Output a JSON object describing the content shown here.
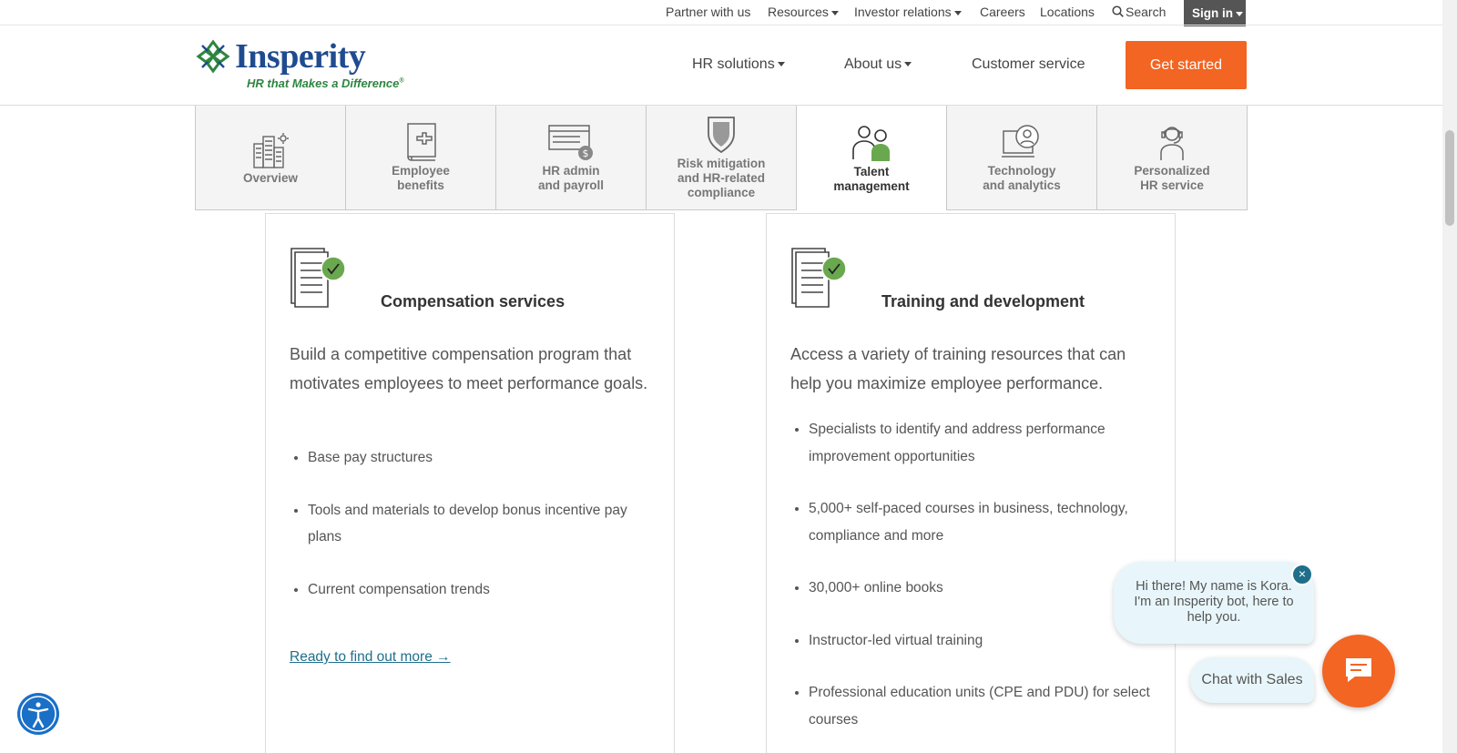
{
  "utility_nav": {
    "partner": "Partner with us",
    "resources": "Resources",
    "investor": "Investor relations",
    "careers": "Careers",
    "locations": "Locations",
    "search": "Search",
    "signin": "Sign in"
  },
  "header": {
    "logo_text": "Insperity",
    "logo_tagline": "HR that Makes a Difference",
    "nav": {
      "hr_solutions": "HR solutions",
      "about_us": "About us",
      "customer_service": "Customer service"
    },
    "cta": "Get started"
  },
  "tabs": [
    {
      "label": "Overview",
      "icon": "buildings-icon"
    },
    {
      "label": "Employee\nbenefits",
      "icon": "medical-book-icon"
    },
    {
      "label": "HR admin\nand payroll",
      "icon": "payroll-check-icon"
    },
    {
      "label": "Risk mitigation\nand HR-related\ncompliance",
      "icon": "shield-icon"
    },
    {
      "label": "Talent\nmanagement",
      "icon": "people-icon",
      "active": true
    },
    {
      "label": "Technology\nand analytics",
      "icon": "monitor-user-icon"
    },
    {
      "label": "Personalized\nHR service",
      "icon": "headset-person-icon"
    }
  ],
  "cards": [
    {
      "title": "Compensation services",
      "intro": "Build a competitive compensation program that motivates employees to meet performance goals.",
      "items": [
        "Base pay structures",
        "Tools and materials to develop bonus incentive pay plans",
        "Current compensation trends"
      ],
      "link": "Ready to find out more →"
    },
    {
      "title": "Training and development",
      "intro": "Access a variety of training resources that can help you maximize employee performance.",
      "items": [
        "Specialists to identify and address performance improvement opportunities",
        "5,000+ self-paced courses in business, technology, compliance and more",
        "30,000+ online books",
        "Instructor-led virtual training",
        "Professional education units (CPE and PDU) for select courses"
      ]
    }
  ],
  "chat": {
    "greeting": "Hi there! My name is Kora. I'm an Insperity bot, here to help you.",
    "close": "×",
    "sales": "Chat with Sales"
  },
  "colors": {
    "accent": "#f26522",
    "brand_blue": "#1f4b8f",
    "brand_green": "#2e8540",
    "link": "#1f6f8b"
  }
}
